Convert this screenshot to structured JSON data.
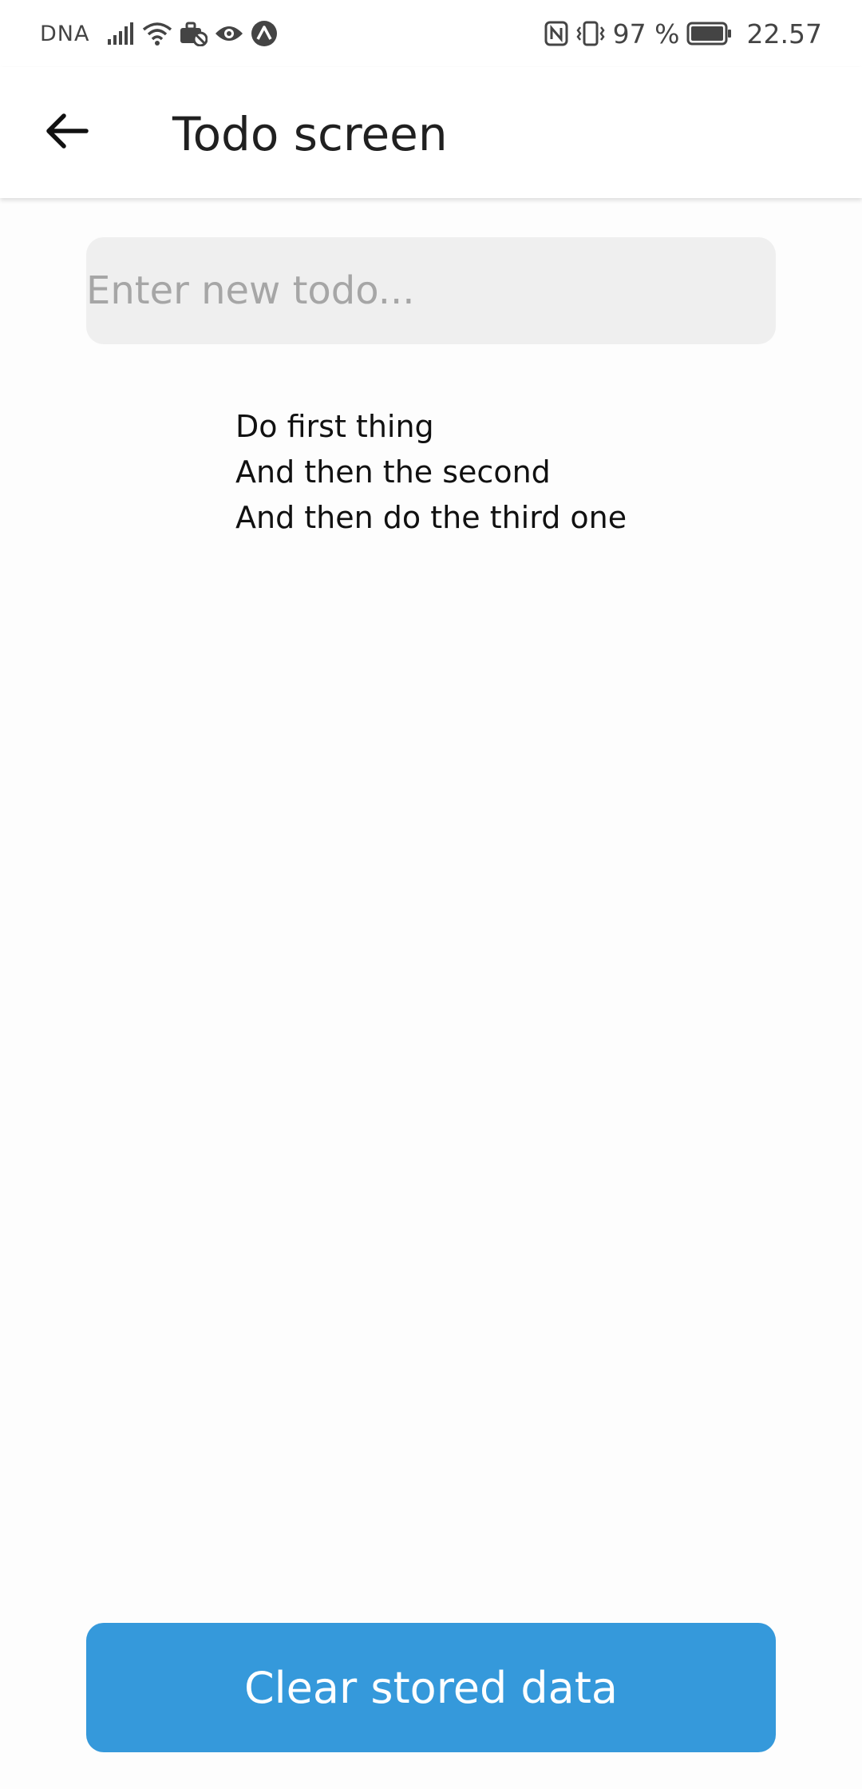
{
  "status_bar": {
    "carrier": "DNA",
    "battery_percent": "97 %",
    "time": "22.57",
    "icons": [
      "signal-icon",
      "wifi-icon",
      "briefcase-icon",
      "eye-icon",
      "expo-icon",
      "nfc-icon",
      "vibrate-icon",
      "battery-icon"
    ]
  },
  "app_bar": {
    "title": "Todo screen",
    "back_icon": "arrow-left-icon"
  },
  "todo_input": {
    "value": "",
    "placeholder": "Enter new todo..."
  },
  "todos": [
    "Do first thing",
    "And then the second",
    "And then do the third one"
  ],
  "clear_button": {
    "label": "Clear stored data"
  },
  "colors": {
    "accent": "#3599db",
    "input_background": "#efefef",
    "page_background": "#fdfdfd"
  }
}
